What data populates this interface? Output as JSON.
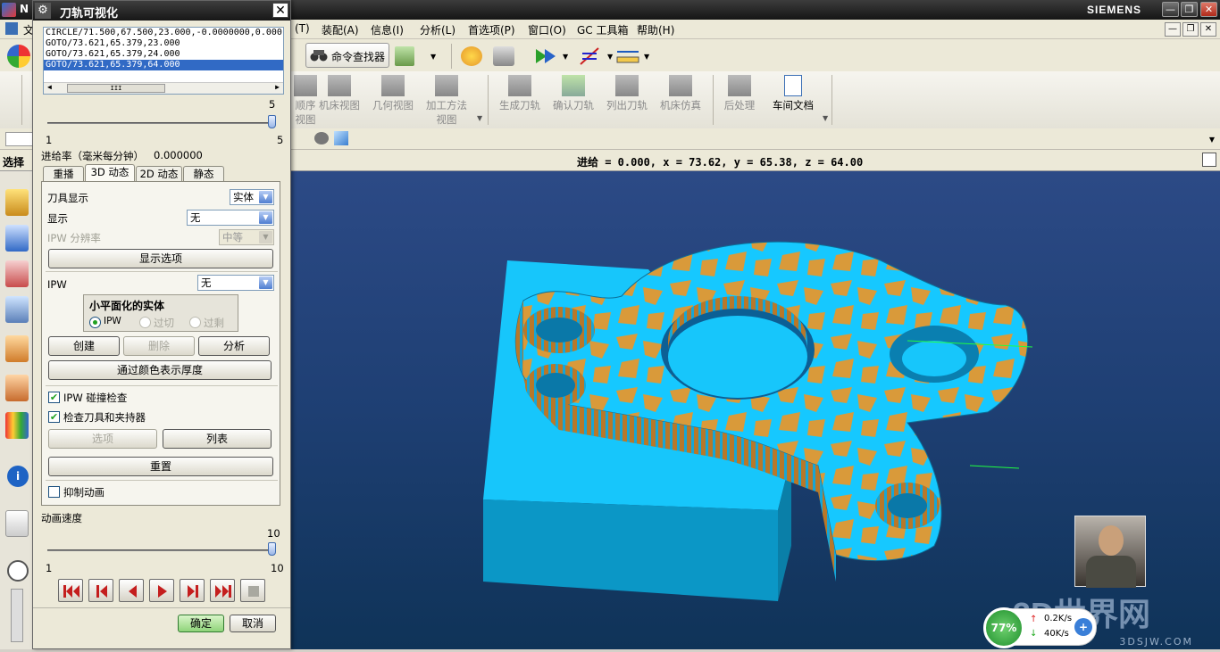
{
  "app": {
    "title_short": "N",
    "brand": "SIEMENS",
    "window_buttons": [
      "—",
      "❐",
      "✕"
    ]
  },
  "menu": {
    "items": [
      "文",
      "(T)",
      "装配(A)",
      "信息(I)",
      "分析(L)",
      "首选项(P)",
      "窗口(O)",
      "GC 工具箱",
      "帮助(H)"
    ]
  },
  "toolbar": {
    "command_finder": "命令查找器"
  },
  "ribbon": {
    "buttons": [
      {
        "label": "顺序",
        "label2": "视图"
      },
      {
        "label": "机床视图"
      },
      {
        "label": "几何视图"
      },
      {
        "label": "加工方法",
        "label2": "视图"
      },
      {
        "label": "生成刀轨"
      },
      {
        "label": "确认刀轨"
      },
      {
        "label": "列出刀轨"
      },
      {
        "label": "机床仿真"
      },
      {
        "label": "后处理"
      },
      {
        "label": "车间文档"
      }
    ]
  },
  "status": {
    "left": "选择",
    "readout": "进给 = 0.000, x = 73.62, y = 65.38, z = 64.00"
  },
  "dialog": {
    "title": "刀轨可视化",
    "close": "✕",
    "gear": "⚙",
    "path_lines": [
      "CIRCLE/71.500,67.500,23.000,-0.0000000,0.000",
      "GOTO/73.621,65.379,23.000",
      "GOTO/73.621,65.379,24.000",
      "GOTO/73.621,65.379,64.000"
    ],
    "path_selected_index": 3,
    "scroll_mid": "III",
    "slider1": {
      "max": "5",
      "min": "1",
      "right": "5",
      "position": 1.0
    },
    "feed_label": "进给率（毫米每分钟）",
    "feed_value": "0.000000",
    "tabs": [
      "重播",
      "3D 动态",
      "2D 动态",
      "静态"
    ],
    "active_tab": 1,
    "tool_display_label": "刀具显示",
    "tool_display_value": "实体",
    "display_label": "显示",
    "display_value": "无",
    "ipw_res_label": "IPW 分辨率",
    "ipw_res_value": "中等",
    "display_options_btn": "显示选项",
    "ipw_label": "IPW",
    "ipw_value": "无",
    "facet_group_title": "小平面化的实体",
    "radio_ipw": "IPW",
    "radio_overcut": "过切",
    "radio_excess": "过剩",
    "create_btn": "创建",
    "delete_btn": "删除",
    "analyze_btn": "分析",
    "thickness_btn": "通过颜色表示厚度",
    "check_ipw_collision": "IPW 碰撞检查",
    "check_tool_holder": "检查刀具和夹持器",
    "options_btn": "选项",
    "list_btn": "列表",
    "reset_btn": "重置",
    "suppress_anim": "抑制动画",
    "anim_speed_label": "动画速度",
    "slider2": {
      "max": "10",
      "min": "1",
      "right": "10",
      "position": 1.0
    },
    "ok_btn": "确定",
    "cancel_btn": "取消"
  },
  "net": {
    "cpu": "77%",
    "up": "0.2K/s",
    "down": "40K/s"
  },
  "watermark": {
    "brand": "3D世界网",
    "url": "3DSJW.COM"
  },
  "colors": {
    "viewport_top": "#2c4a86",
    "part_blue": "#16c8ff",
    "part_orange": "#d99a3a",
    "path_line": "#20ff40"
  }
}
